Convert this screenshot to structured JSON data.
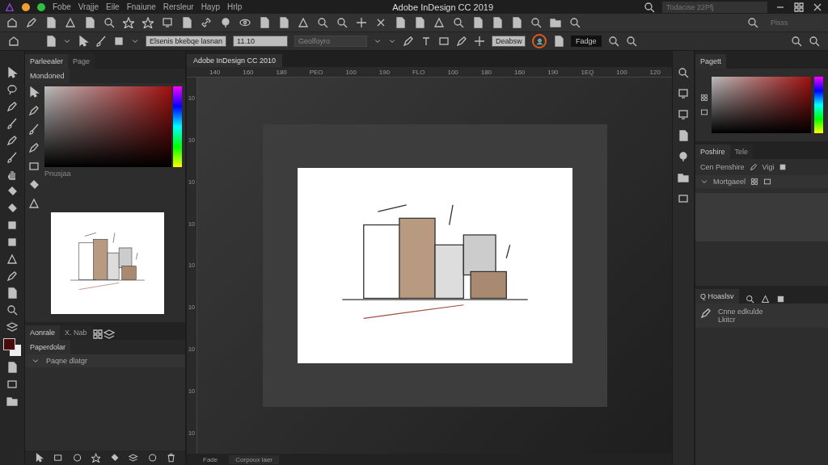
{
  "window": {
    "title": "Adobe InDesign CC 2019",
    "search_placeholder": "Todacise 22Pfj"
  },
  "menu": [
    "Fobe",
    "Vrajje",
    "Eile",
    "Fnaiune",
    "Rersleur",
    "Hayp",
    "Hrlp"
  ],
  "toolbar": {
    "search_placeholder": "Pisss"
  },
  "control_bar": {
    "font_field": "Elsenis bkebqe lasnan",
    "size_field": "11.10",
    "style_dropdown": "Geolfoyro",
    "width_field": "Deabsw",
    "fit_button": "Fadge"
  },
  "left_panel": {
    "tabs": [
      {
        "label": "Parleealer",
        "selected": true
      },
      {
        "label": "Page",
        "selected": false
      }
    ],
    "subtab": "Mondoned",
    "preview_label": "Pnusjaa",
    "lower_tabs": [
      {
        "label": "Aonrale",
        "selected": true
      },
      {
        "label": "X. Nab",
        "selected": false
      }
    ],
    "lower_subtab": "Paperdolar",
    "layer": "Paqne dlatgr"
  },
  "document": {
    "tab": "Adobe InDesign CC 2010",
    "ruler": [
      "140",
      "160",
      "180",
      "PEO",
      "100",
      "190",
      "FLO",
      "100",
      "180",
      "160",
      "190",
      "1EQ",
      "100",
      "120"
    ],
    "vruler": [
      "10",
      "10",
      "10",
      "10",
      "10",
      "10",
      "10",
      "10",
      "10"
    ],
    "page_label": "Fade",
    "layer_dropdown": "Corpoux laer"
  },
  "right_panel": {
    "color_tab": "Pagett",
    "tabs": [
      {
        "label": "Poshire",
        "selected": true
      },
      {
        "label": "Tele",
        "selected": false
      }
    ],
    "row_label": "Cen Penshire",
    "row_value": "Vigi",
    "list_item": "Mortgaeel",
    "lower_tab": "Q Hoaslsv",
    "item_title": "Cnne edkulde",
    "item_sub": "Lkitcr"
  }
}
